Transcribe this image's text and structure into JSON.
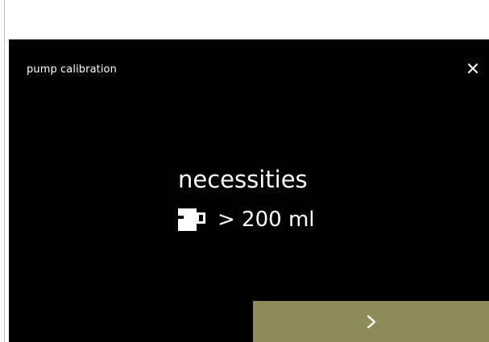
{
  "screen": {
    "title": "pump calibration",
    "close_icon": "close-icon",
    "heading": "necessities",
    "requirement": {
      "icon": "cup-icon",
      "text": "> 200 ml"
    },
    "next_button": {
      "icon": "chevron-right-icon",
      "label": ">",
      "color": "#8d8b58"
    }
  },
  "colors": {
    "screen_background": "#000000",
    "text": "#ffffff",
    "accent": "#8d8b58"
  }
}
